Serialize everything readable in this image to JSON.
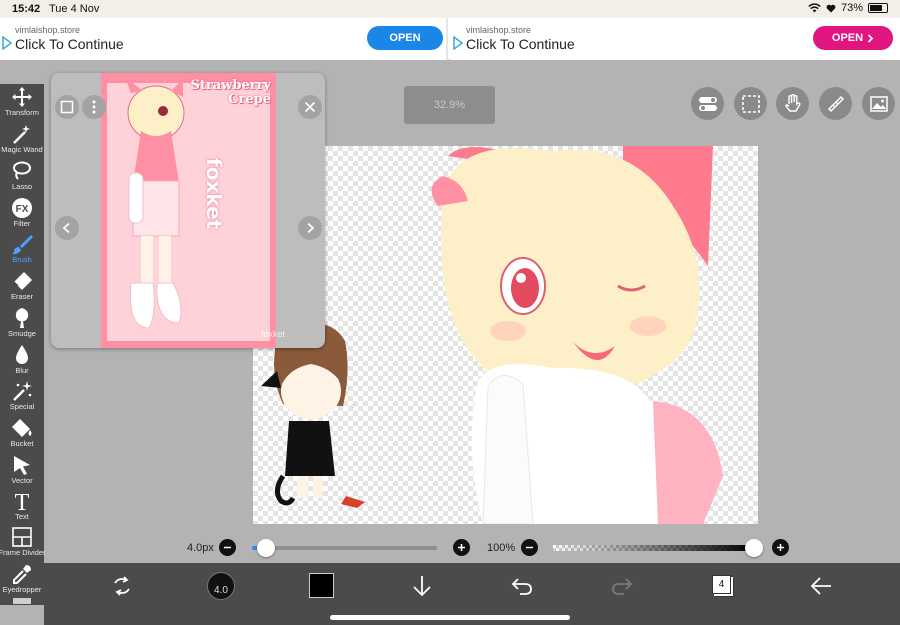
{
  "status": {
    "time": "15:42",
    "date": "Tue 4 Nov",
    "battery": "73%",
    "battery_level": 0.73
  },
  "ads": [
    {
      "domain": "vimlaishop.store",
      "cta": "Click To Continue",
      "button": "OPEN",
      "color": "#1a86e8"
    },
    {
      "domain": "vimlaishop.store",
      "cta": "Click To Continue",
      "button": "OPEN",
      "color": "#e0157f"
    }
  ],
  "tools": [
    {
      "label": "Transform",
      "icon": "move-arrows-icon"
    },
    {
      "label": "Magic Wand",
      "icon": "magic-wand-icon"
    },
    {
      "label": "Lasso",
      "icon": "lasso-icon"
    },
    {
      "label": "Filter",
      "icon": "fx-icon",
      "icon_text": "FX"
    },
    {
      "label": "Brush",
      "icon": "brush-icon",
      "active": true
    },
    {
      "label": "Eraser",
      "icon": "eraser-icon"
    },
    {
      "label": "Smudge",
      "icon": "smudge-icon"
    },
    {
      "label": "Blur",
      "icon": "drop-icon"
    },
    {
      "label": "Special",
      "icon": "sparkle-icon"
    },
    {
      "label": "Bucket",
      "icon": "bucket-icon"
    },
    {
      "label": "Vector",
      "icon": "cursor-icon"
    },
    {
      "label": "Text",
      "icon": "text-icon",
      "icon_text": "T"
    },
    {
      "label": "Frame Divider",
      "icon": "frame-divider-icon"
    },
    {
      "label": "Eyedropper",
      "icon": "eyedropper-icon"
    }
  ],
  "zoom_label": "32.9%",
  "reference": {
    "title": "Strawberry Crepe",
    "vertical_text": "foxket",
    "watermark": "foxket"
  },
  "brush": {
    "size_label": "4.0px",
    "size_fraction": 0.07,
    "opacity_label": "100%",
    "opacity": 1.0,
    "preview_label": "4.0"
  },
  "bottom": {
    "layer_count": "4",
    "color": "#000000"
  },
  "colors": {
    "accent": "#2c8bf0",
    "toolbar": "#4b4b4b"
  }
}
